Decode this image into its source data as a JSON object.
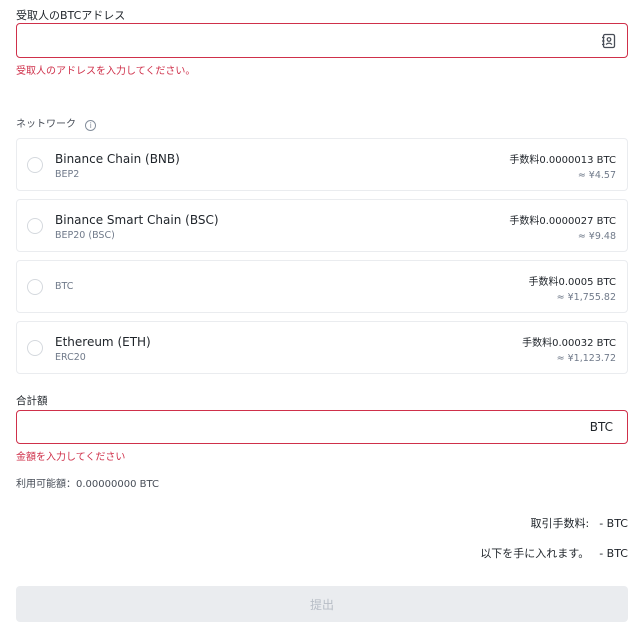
{
  "address": {
    "label": "受取人のBTCアドレス",
    "value": "",
    "placeholder": "",
    "error": "受取人のアドレスを入力してください。"
  },
  "network": {
    "label": "ネットワーク",
    "info_icon": "i",
    "options": [
      {
        "name": "Binance Chain (BNB)",
        "sub": "BEP2",
        "fee": "手数料0.0000013 BTC",
        "fee_jpy": "≈ ¥4.57"
      },
      {
        "name": "Binance Smart Chain (BSC)",
        "sub": "BEP20 (BSC)",
        "fee": "手数料0.0000027 BTC",
        "fee_jpy": "≈ ¥9.48"
      },
      {
        "name": "",
        "sub": "BTC",
        "fee": "手数料0.0005 BTC",
        "fee_jpy": "≈ ¥1,755.82"
      },
      {
        "name": "Ethereum (ETH)",
        "sub": "ERC20",
        "fee": "手数料0.00032 BTC",
        "fee_jpy": "≈ ¥1,123.72"
      }
    ]
  },
  "amount": {
    "label": "合計額",
    "value": "",
    "unit": "BTC",
    "error": "金額を入力してください",
    "available": "利用可能額：0.00000000 BTC"
  },
  "summary": {
    "fee_label": "取引手数料:",
    "fee_value": "- BTC",
    "receive_label": "以下を手に入れます。",
    "receive_value": "- BTC"
  },
  "submit_label": "提出",
  "colors": {
    "error": "#cf304a",
    "border": "#eaecef",
    "disabled_bg": "#eaecef"
  }
}
